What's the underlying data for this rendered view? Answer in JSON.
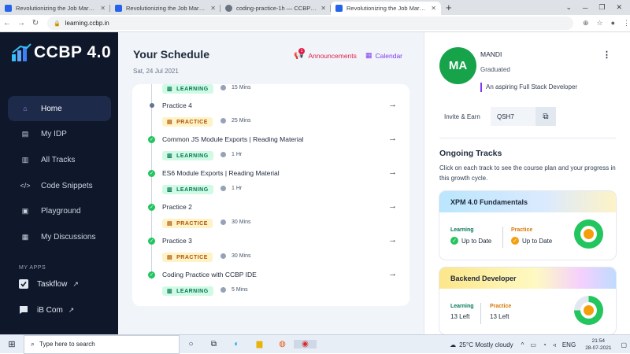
{
  "browser": {
    "tabs": [
      {
        "title": "Revolutionizing the Job Market |",
        "active": false,
        "favicon_color": "#2563eb"
      },
      {
        "title": "Revolutionizing the Job Market |",
        "active": false,
        "favicon_color": "#2563eb"
      },
      {
        "title": "coding-practice-1h — CCBP IDE",
        "active": false,
        "favicon_color": "#6b7280"
      },
      {
        "title": "Revolutionizing the Job Market |",
        "active": true,
        "favicon_color": "#2563eb"
      }
    ],
    "url": "learning.ccbp.in"
  },
  "sidebar": {
    "logo_text": "CCBP 4.0",
    "items": [
      {
        "label": "Home",
        "icon": "home-icon",
        "active": true
      },
      {
        "label": "My IDP",
        "icon": "document-icon",
        "active": false
      },
      {
        "label": "All Tracks",
        "icon": "book-icon",
        "active": false
      },
      {
        "label": "Code Snippets",
        "icon": "code-icon",
        "active": false
      },
      {
        "label": "Playground",
        "icon": "terminal-icon",
        "active": false
      },
      {
        "label": "My Discussions",
        "icon": "chat-icon",
        "active": false
      }
    ],
    "my_apps_heading": "MY APPS",
    "apps": [
      {
        "label": "Taskflow",
        "icon": "checkbox-icon"
      },
      {
        "label": "iB Com",
        "icon": "message-icon"
      }
    ]
  },
  "schedule": {
    "title": "Your Schedule",
    "date": "Sat, 24 Jul 2021",
    "announcements_label": "Announcements",
    "announcements_count": "1",
    "calendar_label": "Calendar",
    "partial_item": {
      "tag": "LEARNING",
      "duration": "15 Mins"
    },
    "items": [
      {
        "title": "Practice 4",
        "tag": "PRACTICE",
        "duration": "25 Mins",
        "completed": false
      },
      {
        "title": "Common JS Module Exports | Reading Material",
        "tag": "LEARNING",
        "duration": "1 Hr",
        "completed": true
      },
      {
        "title": "ES6 Module Exports | Reading Material",
        "tag": "LEARNING",
        "duration": "1 Hr",
        "completed": true
      },
      {
        "title": "Practice 2",
        "tag": "PRACTICE",
        "duration": "30 Mins",
        "completed": true
      },
      {
        "title": "Practice 3",
        "tag": "PRACTICE",
        "duration": "30 Mins",
        "completed": true
      },
      {
        "title": "Coding Practice with CCBP IDE",
        "tag": "LEARNING",
        "duration": "5 Mins",
        "completed": true
      }
    ]
  },
  "profile": {
    "initials": "MA",
    "name": "MANDI",
    "status": "Graduated",
    "tagline": "An aspiring Full Stack Developer",
    "invite_label": "Invite & Earn",
    "invite_code": "QSH7"
  },
  "ongoing": {
    "title": "Ongoing Tracks",
    "description": "Click on each track to see the course plan and your progress in this growth cycle.",
    "tracks": [
      {
        "name": "XPM 4.0 Fundamentals",
        "learning_label": "Learning",
        "learning_value": "Up to Date",
        "practice_label": "Practice",
        "practice_value": "Up to Date",
        "learning_progress": 1.0
      },
      {
        "name": "Backend Developer",
        "learning_label": "Learning",
        "learning_value": "13 Left",
        "practice_label": "Practice",
        "practice_value": "13 Left",
        "learning_progress": 0.75
      }
    ]
  },
  "taskbar": {
    "search_placeholder": "Type here to search",
    "weather": "25°C  Mostly cloudy",
    "lang": "ENG",
    "time": "21:54",
    "date": "28-07-2021"
  },
  "colors": {
    "sidebar_bg": "#0f172a",
    "accent_purple": "#7c3aed",
    "learning_green": "#047857",
    "practice_orange": "#b45309",
    "avatar_green": "#16a34a"
  }
}
